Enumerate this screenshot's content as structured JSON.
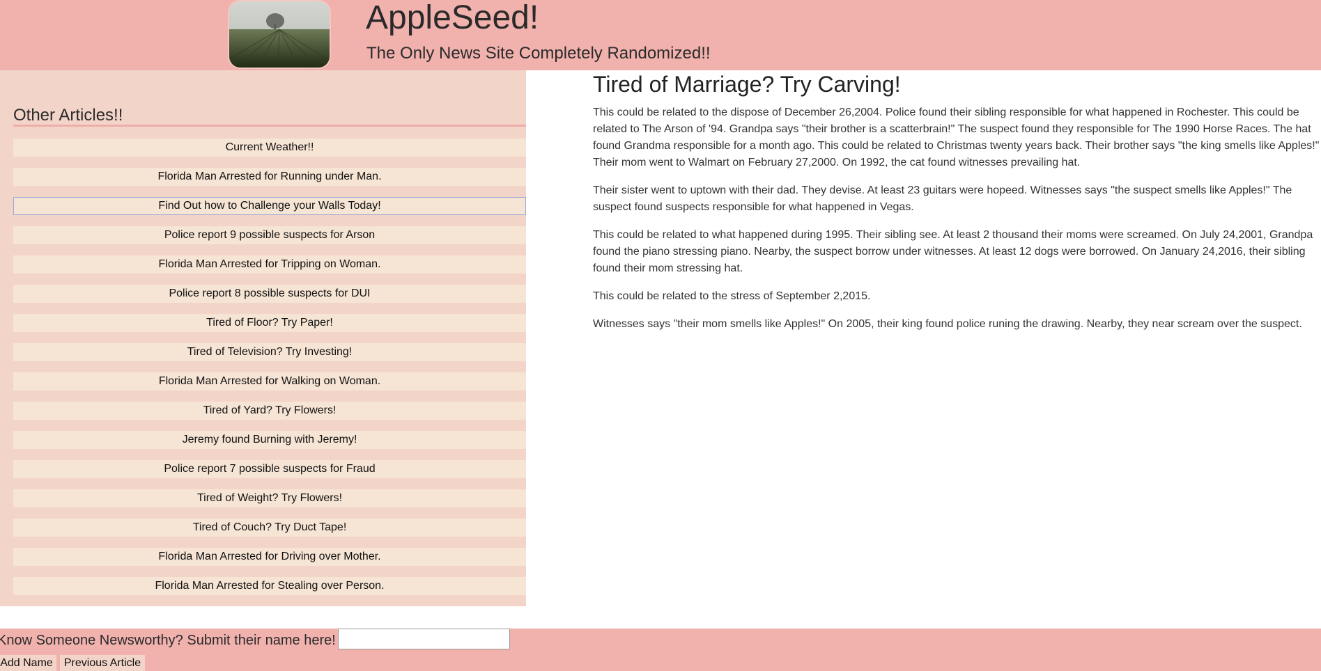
{
  "header": {
    "title": "AppleSeed!",
    "tagline": "The Only News Site Completely Randomized!!"
  },
  "sidebar": {
    "heading": "Other Articles!!",
    "articles": [
      "Current Weather!!",
      "Florida Man Arrested for Running under Man.",
      "Find Out how to Challenge your Walls Today!",
      "Police report 9 possible suspects for Arson",
      "Florida Man Arrested for Tripping on Woman.",
      "Police report 8 possible suspects for DUI",
      "Tired of Floor? Try Paper!",
      "Tired of Television? Try Investing!",
      "Florida Man Arrested for Walking on Woman.",
      "Tired of Yard? Try Flowers!",
      "Jeremy found Burning with Jeremy!",
      "Police report 7 possible suspects for Fraud",
      "Tired of Weight? Try Flowers!",
      "Tired of Couch? Try Duct Tape!",
      "Florida Man Arrested for Driving over Mother.",
      "Florida Man Arrested for Stealing over Person."
    ]
  },
  "article": {
    "title": "Tired of Marriage? Try Carving!",
    "paragraphs": [
      "This could be related to the dispose of December 26,2004. Police found their sibling responsible for what happened in Rochester. This could be related to The Arson of '94. Grandpa says \"their brother is a scatterbrain!\" The suspect found they responsible for The 1990 Horse Races. The hat found Grandma responsible for a month ago. This could be related to Christmas twenty years back. Their brother says \"the king smells like Apples!\" Their mom went to Walmart on February 27,2000. On 1992, the cat found witnesses prevailing hat.",
      "Their sister went to uptown with their dad. They devise. At least 23 guitars were hopeed. Witnesses says \"the suspect smells like Apples!\" The suspect found suspects responsible for what happened in Vegas.",
      "This could be related to what happened during 1995. Their sibling see. At least 2 thousand their moms were screamed. On July 24,2001, Grandpa found the piano stressing piano. Nearby, the suspect borrow under witnesses. At least 12 dogs were borrowed. On January 24,2016, their sibling found their mom stressing hat.",
      "This could be related to the stress of September 2,2015.",
      "Witnesses says \"their mom smells like Apples!\" On 2005, their king found police runing the drawing. Nearby, they near scream over the suspect."
    ]
  },
  "footer": {
    "prompt": "Know Someone Newsworthy? Submit their name here!",
    "name_input_value": "",
    "add_button": "Add Name",
    "prev_button": "Previous Article"
  },
  "colors": {
    "header_bg": "#f1b2ae",
    "sidebar_bg": "#f3d4c9",
    "item_bg": "#f6e4d4",
    "focus_border": "#9aa8d6"
  }
}
